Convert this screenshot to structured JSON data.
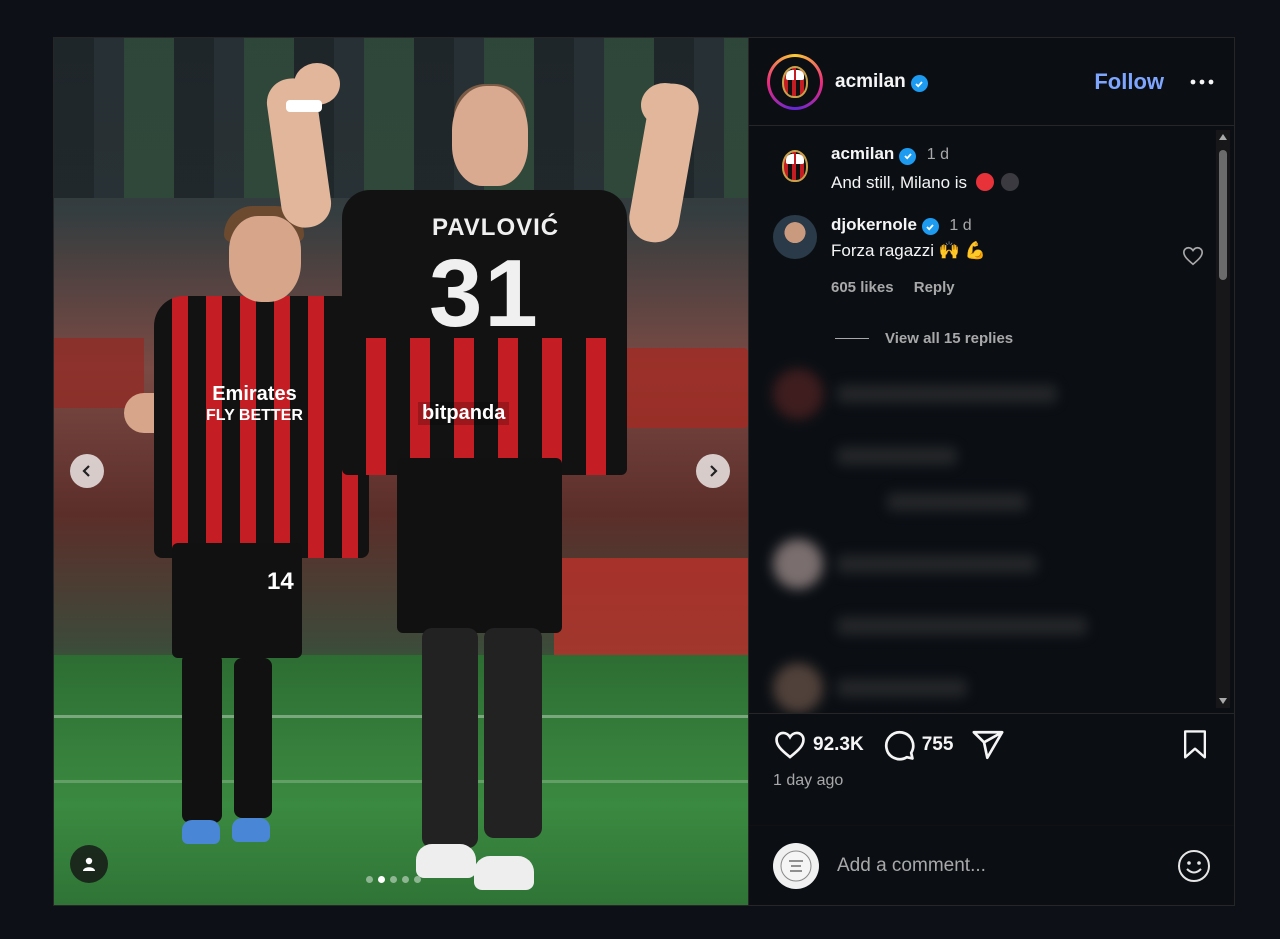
{
  "post": {
    "author": "acmilan",
    "follow_label": "Follow",
    "caption_user": "acmilan",
    "caption_time": "1 d",
    "caption_text": "And still, Milano is",
    "caption_emojis": [
      "red-circle",
      "black-circle"
    ],
    "likes_count": "92.3K",
    "comments_count": "755",
    "posted_ago": "1 day ago",
    "carousel": {
      "slides": 5,
      "active_slide": 2
    }
  },
  "image_text": {
    "player_name": "PAVLOVIĆ",
    "player_number": "31",
    "sponsor_back": "bitpanda",
    "sponsor_front_line1": "Emirates",
    "sponsor_front_line2": "FLY BETTER",
    "other_number": "14"
  },
  "comments": [
    {
      "user": "djokernole",
      "time": "1 d",
      "text": "Forza ragazzi 🙌 💪",
      "likes": "605 likes",
      "reply_label": "Reply",
      "view_replies": "View all 15 replies"
    }
  ],
  "add_comment": {
    "placeholder": "Add a comment..."
  },
  "colors": {
    "accent": "#7ea6ff",
    "verified": "#1d9bf0",
    "milan_red": "#c41d23"
  },
  "icons": [
    "verified-badge",
    "more-icon",
    "heart-icon",
    "comment-icon",
    "share-icon",
    "bookmark-icon",
    "emoji-icon",
    "chevron-left-icon",
    "chevron-right-icon",
    "user-tag-icon"
  ]
}
